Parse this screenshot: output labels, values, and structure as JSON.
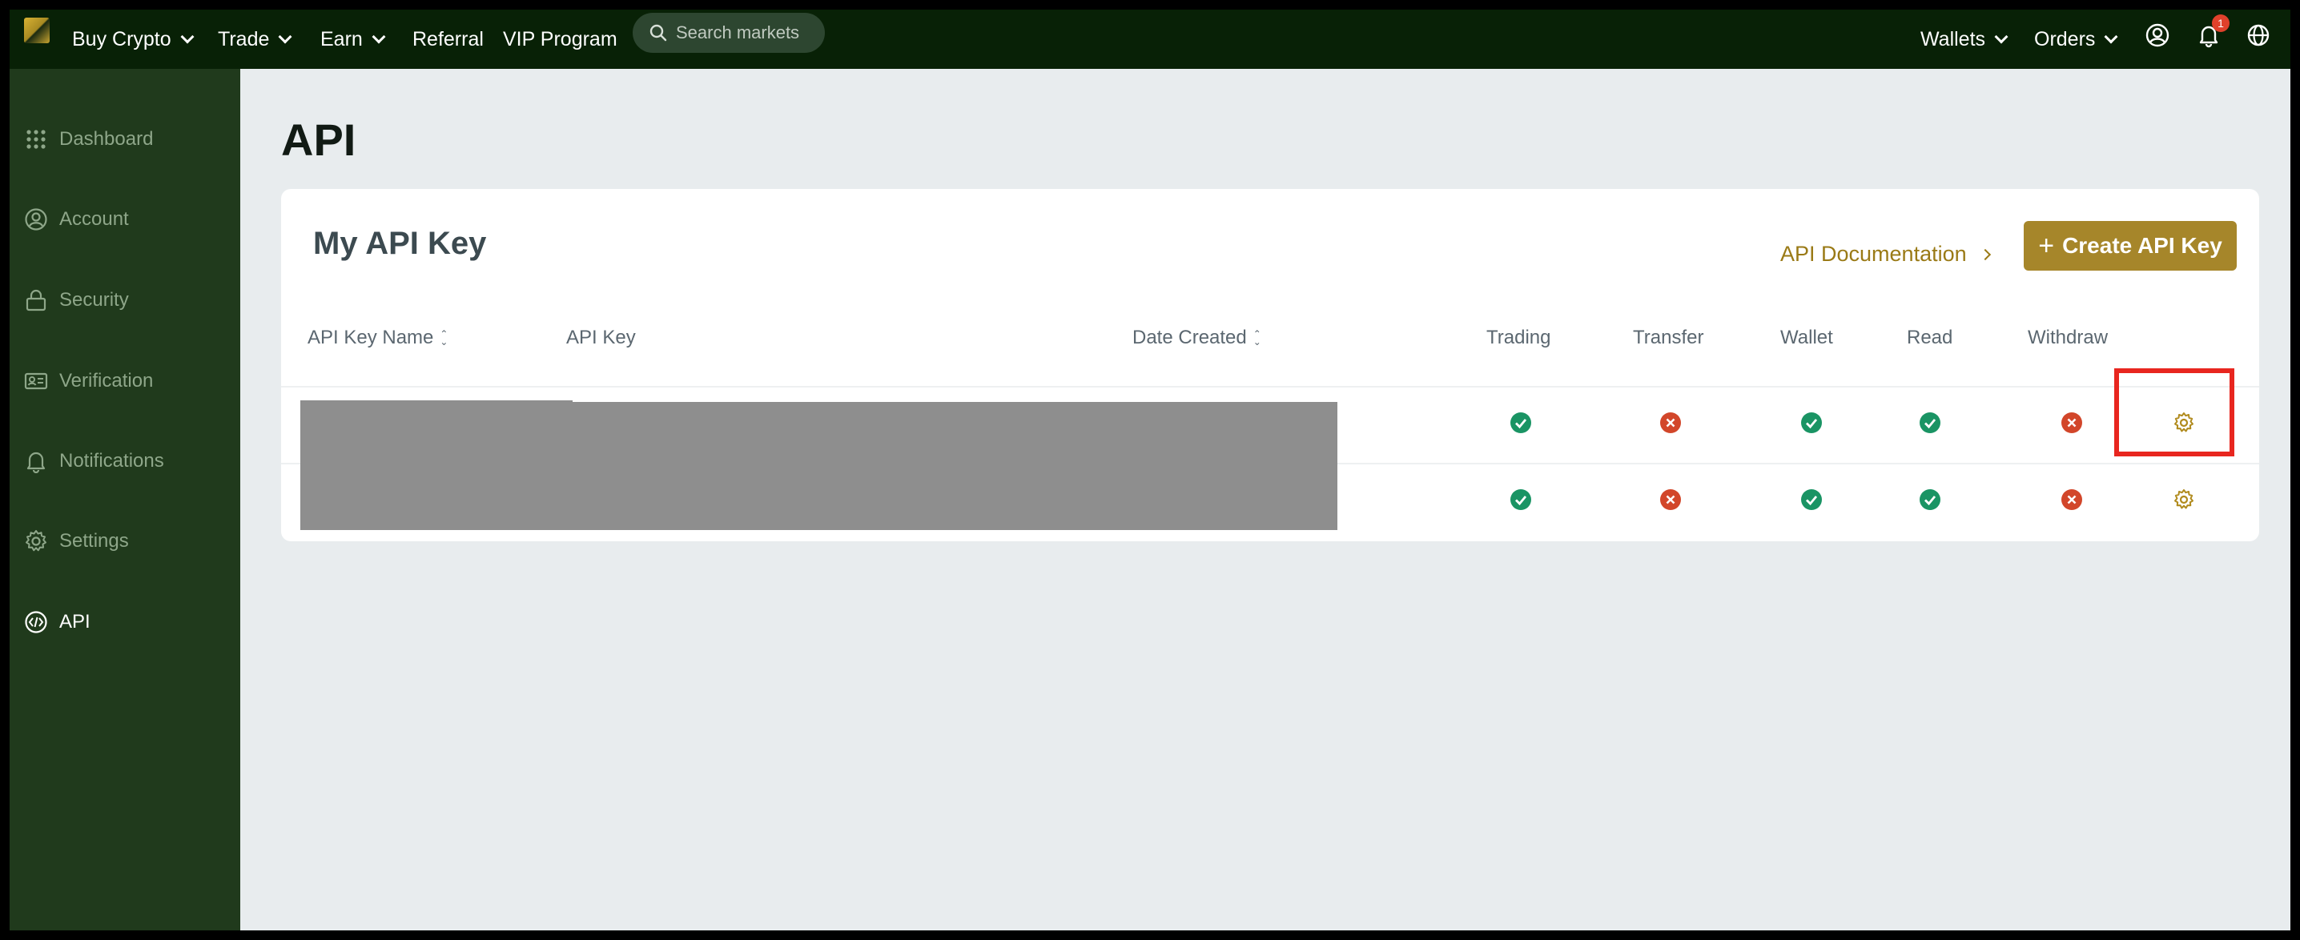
{
  "topbar": {
    "nav": [
      {
        "label": "Buy Crypto",
        "dropdown": true
      },
      {
        "label": "Trade",
        "dropdown": true
      },
      {
        "label": "Earn",
        "dropdown": true
      },
      {
        "label": "Referral",
        "dropdown": false
      },
      {
        "label": "VIP Program",
        "dropdown": false
      }
    ],
    "search_placeholder": "Search markets",
    "wallets_label": "Wallets",
    "orders_label": "Orders",
    "notification_count": "1"
  },
  "sidebar": {
    "items": [
      {
        "label": "Dashboard",
        "icon": "grid-icon",
        "active": false
      },
      {
        "label": "Account",
        "icon": "user-icon",
        "active": false
      },
      {
        "label": "Security",
        "icon": "lock-icon",
        "active": false
      },
      {
        "label": "Verification",
        "icon": "id-card-icon",
        "active": false
      },
      {
        "label": "Notifications",
        "icon": "bell-icon",
        "active": false
      },
      {
        "label": "Settings",
        "icon": "gear-icon",
        "active": false
      },
      {
        "label": "API",
        "icon": "code-icon",
        "active": true
      }
    ]
  },
  "main": {
    "page_title": "API",
    "card_title": "My API Key",
    "doc_link": "API Documentation",
    "create_button": "Create API Key",
    "columns": {
      "name": "API Key Name",
      "key": "API Key",
      "date": "Date Created",
      "trading": "Trading",
      "transfer": "Transfer",
      "wallet": "Wallet",
      "read": "Read",
      "withdraw": "Withdraw"
    },
    "rows": [
      {
        "trading": true,
        "transfer": false,
        "wallet": true,
        "read": true,
        "withdraw": false
      },
      {
        "trading": true,
        "transfer": false,
        "wallet": true,
        "read": true,
        "withdraw": false
      }
    ]
  },
  "colors": {
    "topbar": "#082106",
    "sidebar": "#203a1c",
    "accent": "#a6862a",
    "check": "#1a9464",
    "cross": "#d2462a",
    "highlight": "#e8261f"
  }
}
